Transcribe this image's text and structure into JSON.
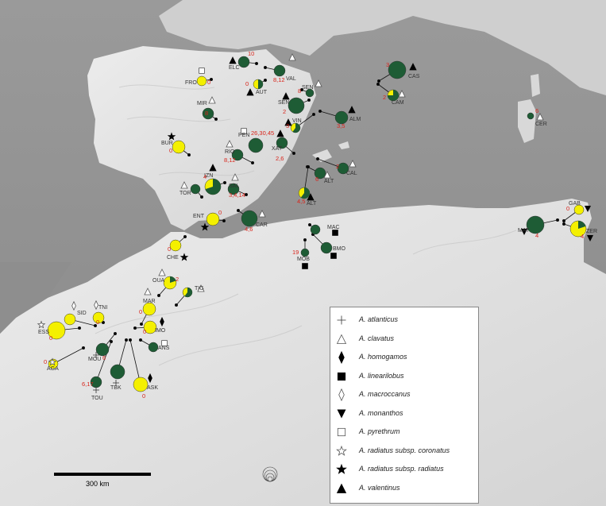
{
  "colors": {
    "sea": "#8c8c8c",
    "land": "#e2e2e2",
    "green": "#1e5c35",
    "yellow": "#f4f000",
    "red": "#d9261c"
  },
  "scale_bar": {
    "label": "300 km"
  },
  "legend": [
    {
      "symbol": "plus",
      "prefix": "A.",
      "name": "atlanticus"
    },
    {
      "symbol": "triangle-open",
      "prefix": "A.",
      "name": "clavatus"
    },
    {
      "symbol": "diamond-filled",
      "prefix": "A.",
      "name": "homogamos"
    },
    {
      "symbol": "square-filled",
      "prefix": "A.",
      "name": "linearilobus"
    },
    {
      "symbol": "diamond-open",
      "prefix": "A.",
      "name": "macroccanus"
    },
    {
      "symbol": "triangle-down-filled",
      "prefix": "A.",
      "name": "monanthos"
    },
    {
      "symbol": "square-open",
      "prefix": "A.",
      "name": "pyrethrum"
    },
    {
      "symbol": "star-open",
      "prefix": "A.",
      "name": "radiatus subsp. coronatus"
    },
    {
      "symbol": "star-filled",
      "prefix": "A.",
      "name": "radiatus subsp. radiatus"
    },
    {
      "symbol": "triangle-filled",
      "prefix": "A.",
      "name": "valentinus"
    }
  ],
  "populations": [
    {
      "code": "ELC",
      "number": "10",
      "green": 1.0,
      "symbol": "triangle-filled"
    },
    {
      "code": "VAL",
      "number": "8,12",
      "green": 1.0,
      "symbol": "triangle-open"
    },
    {
      "code": "FRO",
      "number": "0",
      "green": 0.0,
      "symbol": "square-open"
    },
    {
      "code": "AUT",
      "number": "0",
      "green": 0.5,
      "symbol": "triangle-filled"
    },
    {
      "code": "SEN",
      "number": "8",
      "green": 1.0,
      "symbol": "triangle-open"
    },
    {
      "code": "SEN",
      "number": "2",
      "green": 1.0,
      "symbol": "triangle-filled"
    },
    {
      "code": "VIN",
      "number": "3",
      "green": 0.6,
      "symbol": "triangle-filled"
    },
    {
      "code": "CAS",
      "number": "3",
      "green": 1.0,
      "symbol": "triangle-filled"
    },
    {
      "code": "CAM",
      "number": "2",
      "green": 0.75,
      "symbol": "triangle-open"
    },
    {
      "code": "MIR",
      "number": "8",
      "green": 1.0,
      "symbol": "triangle-open"
    },
    {
      "code": "ALM",
      "number": "3,5",
      "green": 1.0,
      "symbol": "triangle-filled"
    },
    {
      "code": "CER",
      "number": "6",
      "green": 1.0,
      "symbol": "triangle-open"
    },
    {
      "code": "PEN",
      "number": "26,30,45",
      "green": 1.0,
      "symbol": "square-open"
    },
    {
      "code": "BUR",
      "number": "0",
      "green": 0.0,
      "symbol": "star-filled"
    },
    {
      "code": "RIO",
      "number": "8,12",
      "green": 1.0,
      "symbol": "triangle-open"
    },
    {
      "code": "XAT",
      "number": "2,6",
      "green": 1.0,
      "symbol": "triangle-filled"
    },
    {
      "code": "CAL",
      "number": "2",
      "green": 1.0,
      "symbol": "triangle-open"
    },
    {
      "code": "IZN",
      "number": "4",
      "green": 0.7,
      "symbol": "triangle-filled"
    },
    {
      "code": "ALT",
      "number": "6",
      "green": 1.0,
      "symbol": "triangle-open"
    },
    {
      "code": "TOR",
      "number": "",
      "green": 1.0,
      "symbol": "triangle-open"
    },
    {
      "code": "SAL",
      "number": "3,4,14",
      "green": 1.0,
      "symbol": "triangle-open"
    },
    {
      "code": "ALT",
      "number": "4,5",
      "green": 0.6,
      "symbol": "triangle-filled"
    },
    {
      "code": "ENT",
      "number": "0",
      "green": 0.0,
      "symbol": "star-filled"
    },
    {
      "code": "CAR",
      "number": "4,6",
      "green": 1.0,
      "symbol": "triangle-open"
    },
    {
      "code": "GAB",
      "number": "0",
      "green": 0.0,
      "symbol": "triangle-down-filled"
    },
    {
      "code": "MAT",
      "number": "4",
      "green": 1.0,
      "symbol": "triangle-down-filled"
    },
    {
      "code": "ZER",
      "number": "4",
      "green": 0.2,
      "symbol": "triangle-down-filled"
    },
    {
      "code": "MAC",
      "number": "",
      "green": 1.0,
      "symbol": "square-filled"
    },
    {
      "code": "MOB",
      "number": "19",
      "green": 1.0,
      "symbol": "square-filled"
    },
    {
      "code": "BMO",
      "number": "",
      "green": 1.0,
      "symbol": "square-filled"
    },
    {
      "code": "CHE",
      "number": "0",
      "green": 0.0,
      "symbol": "star-filled"
    },
    {
      "code": "OUA",
      "number": "2",
      "green": 0.2,
      "symbol": "triangle-open"
    },
    {
      "code": "TIG",
      "number": "",
      "green": 0.6,
      "symbol": "triangle-open"
    },
    {
      "code": "SID",
      "number": "",
      "green": 0.0,
      "symbol": "diamond-open"
    },
    {
      "code": "TNI",
      "number": "0",
      "green": 0.0,
      "symbol": "diamond-open"
    },
    {
      "code": "MAR",
      "number": "0",
      "green": 0.0,
      "symbol": "triangle-open"
    },
    {
      "code": "IMO",
      "number": "0",
      "green": 0.0,
      "symbol": "diamond-filled"
    },
    {
      "code": "ESS",
      "number": "0",
      "green": 0.0,
      "symbol": "star-open"
    },
    {
      "code": "ANS",
      "number": "",
      "green": 1.0,
      "symbol": "square-open"
    },
    {
      "code": "MOU",
      "number": "6",
      "green": 1.0,
      "symbol": "plus"
    },
    {
      "code": "AGA",
      "number": "0",
      "green": 0.0,
      "symbol": "star-open"
    },
    {
      "code": "TBK",
      "number": "",
      "green": 1.0,
      "symbol": "plus"
    },
    {
      "code": "TOU",
      "number": "6,17",
      "green": 1.0,
      "symbol": "plus"
    },
    {
      "code": "ASK",
      "number": "0",
      "green": 0.0,
      "symbol": "diamond-filled"
    }
  ]
}
